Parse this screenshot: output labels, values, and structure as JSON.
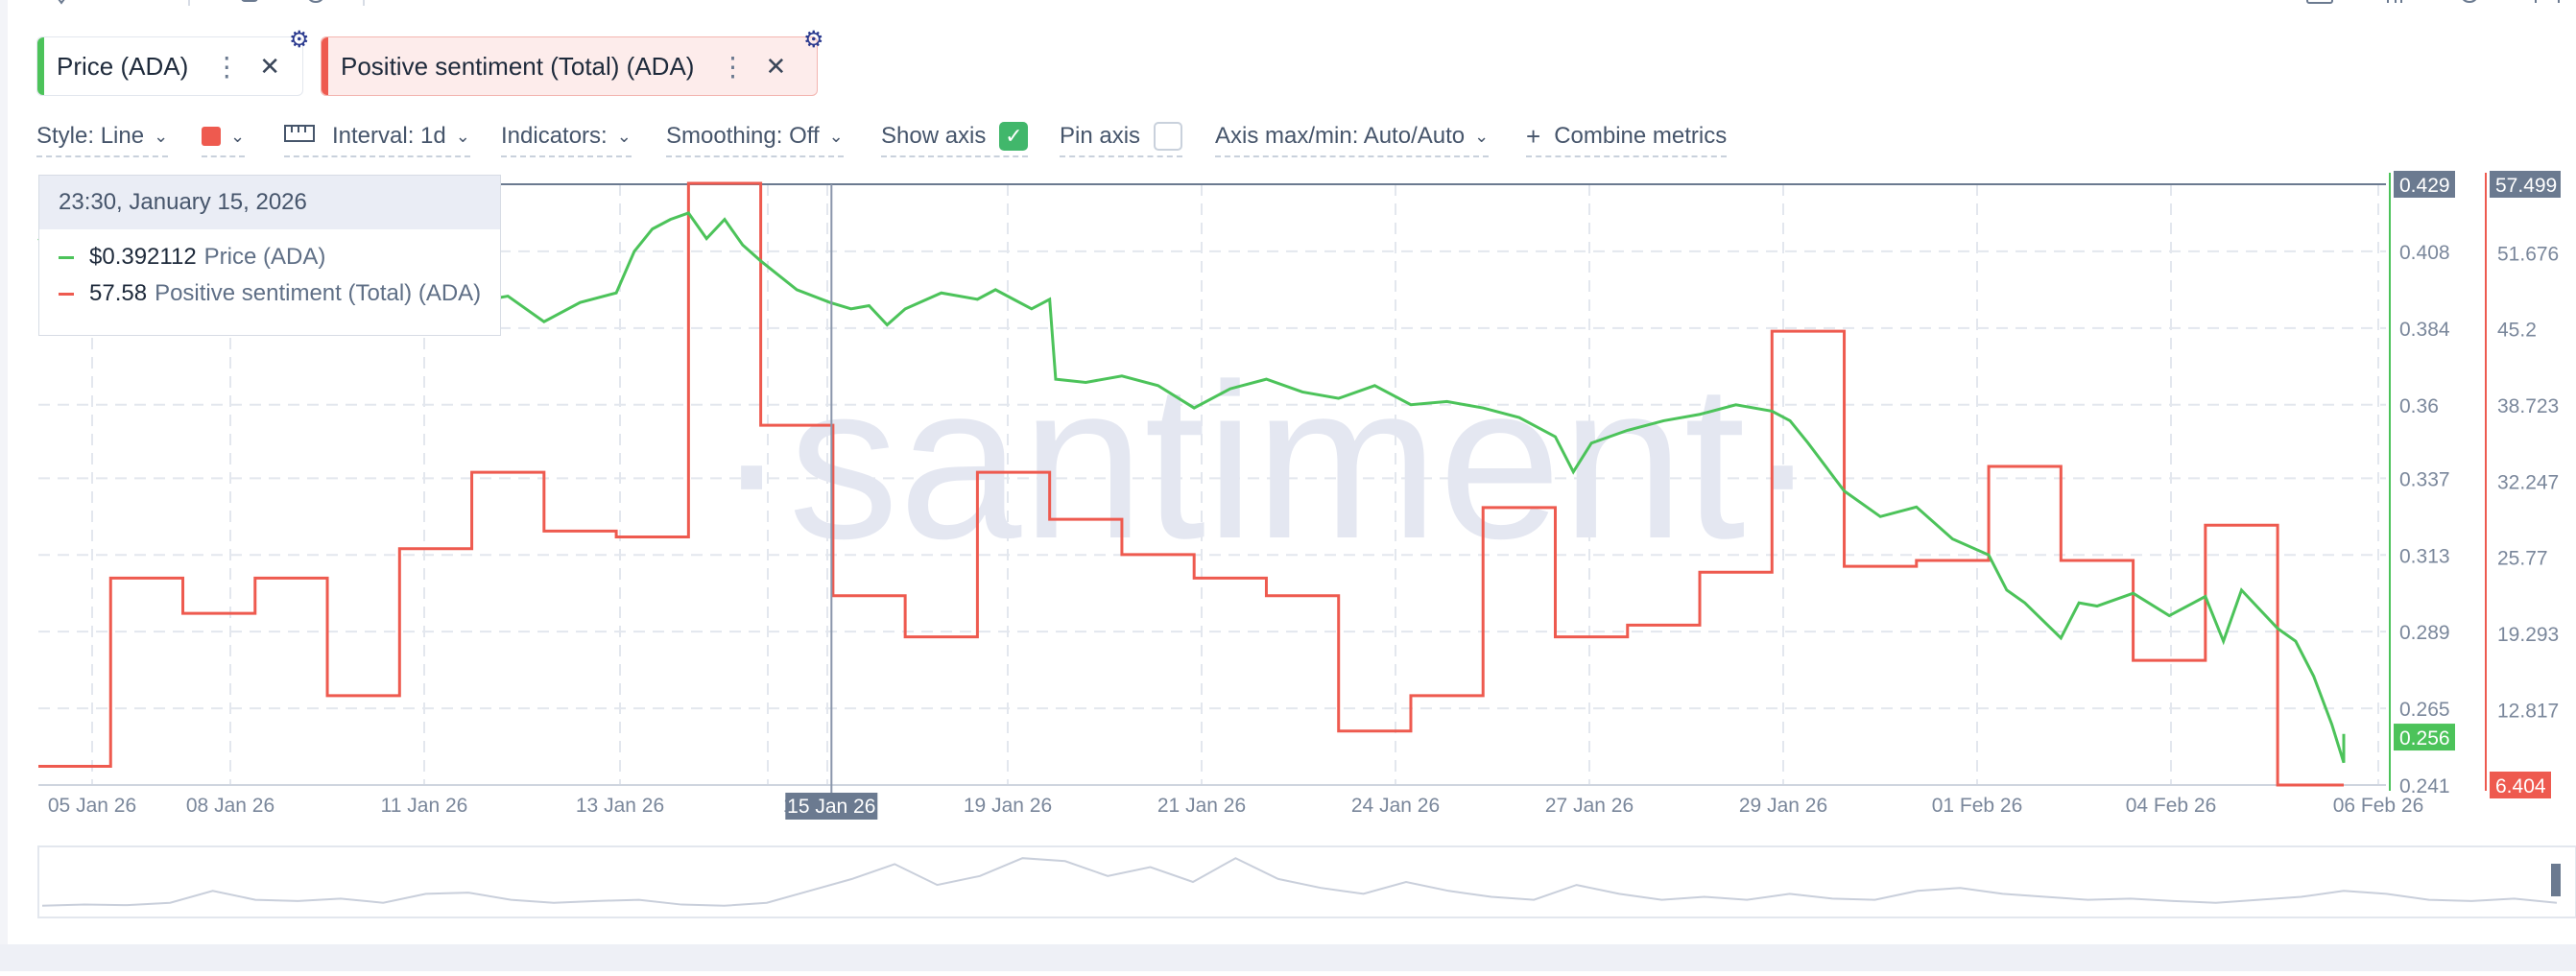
{
  "chips": [
    {
      "label": "Price (ADA)",
      "color": "#4cc35a"
    },
    {
      "label": "Positive sentiment (Total) (ADA)",
      "color": "#ee5a4f"
    }
  ],
  "toolbar": {
    "style": "Style: Line",
    "interval": "Interval: 1d",
    "indicators": "Indicators:",
    "smoothing": "Smoothing: Off",
    "show_axis": "Show axis",
    "pin_axis": "Pin axis",
    "axis_maxmin": "Axis max/min: Auto/Auto",
    "combine": "Combine metrics",
    "show_axis_checked": true,
    "pin_axis_checked": false
  },
  "tooltip": {
    "datetime": "23:30, January 15, 2026",
    "rows": [
      {
        "value": "$0.392112",
        "name": "Price (ADA)",
        "color": "#4cc35a"
      },
      {
        "value": "57.58",
        "name": "Positive sentiment (Total) (ADA)",
        "color": "#ee5a4f"
      }
    ]
  },
  "watermark": "·santiment·",
  "chart_data": {
    "type": "line",
    "x_tick_labels": [
      "05 Jan 26",
      "08 Jan 26",
      "11 Jan 26",
      "13 Jan 26",
      "15 Jan 26",
      "17 Jan 26",
      "19 Jan 26",
      "21 Jan 26",
      "24 Jan 26",
      "27 Jan 26",
      "29 Jan 26",
      "01 Feb 26",
      "04 Feb 26",
      "06 Feb 26"
    ],
    "highlighted_x_label": "15 Jan 26",
    "xlim": [
      "2026-01-05",
      "2026-02-06"
    ],
    "price_axis": {
      "ticks": [
        "0.408",
        "0.384",
        "0.36",
        "0.337",
        "0.313",
        "0.289",
        "0.265",
        "0.241"
      ],
      "ylim": [
        0.241,
        0.429
      ],
      "max_badge": "0.429",
      "last_badge": "0.256",
      "color": "#4cc35a"
    },
    "sentiment_axis": {
      "ticks": [
        "51.676",
        "45.2",
        "38.723",
        "32.247",
        "25.77",
        "19.293",
        "12.817"
      ],
      "ylim": [
        6.404,
        57.499
      ],
      "max_badge": "57.499",
      "min_badge": "6.404",
      "color": "#ee5a4f"
    },
    "grid": true,
    "series": [
      {
        "name": "Price (ADA)",
        "color": "#4cc35a",
        "step": false,
        "points": [
          [
            "2026-01-05",
            0.412
          ],
          [
            "2026-01-05T12",
            0.405
          ],
          [
            "2026-01-06",
            0.41
          ],
          [
            "2026-01-06T12",
            0.4
          ],
          [
            "2026-01-07",
            0.39
          ],
          [
            "2026-01-07T12",
            0.398
          ],
          [
            "2026-01-08",
            0.385
          ],
          [
            "2026-01-08T12",
            0.39
          ],
          [
            "2026-01-09",
            0.395
          ],
          [
            "2026-01-09T12",
            0.388
          ],
          [
            "2026-01-10",
            0.39
          ],
          [
            "2026-01-10T12",
            0.386
          ],
          [
            "2026-01-11",
            0.392
          ],
          [
            "2026-01-11T12",
            0.394
          ],
          [
            "2026-01-12",
            0.386
          ],
          [
            "2026-01-12T12",
            0.392
          ],
          [
            "2026-01-13",
            0.395
          ],
          [
            "2026-01-13T06",
            0.408
          ],
          [
            "2026-01-13T12",
            0.415
          ],
          [
            "2026-01-13T18",
            0.418
          ],
          [
            "2026-01-14",
            0.42
          ],
          [
            "2026-01-14T06",
            0.412
          ],
          [
            "2026-01-14T12",
            0.418
          ],
          [
            "2026-01-14T18",
            0.41
          ],
          [
            "2026-01-15",
            0.405
          ],
          [
            "2026-01-15T12",
            0.396
          ],
          [
            "2026-01-15T23",
            0.392
          ],
          [
            "2026-01-16T06",
            0.39
          ],
          [
            "2026-01-16T12",
            0.391
          ],
          [
            "2026-01-16T18",
            0.385
          ],
          [
            "2026-01-17",
            0.39
          ],
          [
            "2026-01-17T12",
            0.395
          ],
          [
            "2026-01-18",
            0.393
          ],
          [
            "2026-01-18T06",
            0.396
          ],
          [
            "2026-01-18T12",
            0.393
          ],
          [
            "2026-01-18T18",
            0.39
          ],
          [
            "2026-01-19",
            0.393
          ],
          [
            "2026-01-19T02",
            0.368
          ],
          [
            "2026-01-19T12",
            0.367
          ],
          [
            "2026-01-20",
            0.369
          ],
          [
            "2026-01-20T12",
            0.366
          ],
          [
            "2026-01-21",
            0.359
          ],
          [
            "2026-01-21T12",
            0.365
          ],
          [
            "2026-01-22",
            0.368
          ],
          [
            "2026-01-22T12",
            0.364
          ],
          [
            "2026-01-23",
            0.362
          ],
          [
            "2026-01-23T12",
            0.366
          ],
          [
            "2026-01-24",
            0.36
          ],
          [
            "2026-01-24T12",
            0.361
          ],
          [
            "2026-01-25",
            0.359
          ],
          [
            "2026-01-25T12",
            0.356
          ],
          [
            "2026-01-26",
            0.35
          ],
          [
            "2026-01-26T06",
            0.339
          ],
          [
            "2026-01-26T12",
            0.348
          ],
          [
            "2026-01-27",
            0.352
          ],
          [
            "2026-01-27T12",
            0.355
          ],
          [
            "2026-01-28",
            0.357
          ],
          [
            "2026-01-28T12",
            0.36
          ],
          [
            "2026-01-29",
            0.358
          ],
          [
            "2026-01-29T06",
            0.355
          ],
          [
            "2026-01-29T12",
            0.348
          ],
          [
            "2026-01-30",
            0.333
          ],
          [
            "2026-01-30T12",
            0.325
          ],
          [
            "2026-01-31",
            0.328
          ],
          [
            "2026-01-31T12",
            0.318
          ],
          [
            "2026-02-01",
            0.313
          ],
          [
            "2026-02-01T06",
            0.302
          ],
          [
            "2026-02-01T12",
            0.298
          ],
          [
            "2026-02-02",
            0.287
          ],
          [
            "2026-02-02T06",
            0.298
          ],
          [
            "2026-02-02T12",
            0.297
          ],
          [
            "2026-02-03",
            0.301
          ],
          [
            "2026-02-03T12",
            0.294
          ],
          [
            "2026-02-04",
            0.3
          ],
          [
            "2026-02-04T06",
            0.286
          ],
          [
            "2026-02-04T12",
            0.302
          ],
          [
            "2026-02-05",
            0.29
          ],
          [
            "2026-02-05T06",
            0.286
          ],
          [
            "2026-02-05T12",
            0.275
          ],
          [
            "2026-02-05T18",
            0.26
          ],
          [
            "2026-02-06",
            0.248
          ],
          [
            "2026-02-06T06",
            0.257
          ],
          [
            "2026-02-06T12",
            0.252
          ],
          [
            "2026-02-06T18",
            0.256
          ]
        ]
      },
      {
        "name": "Positive sentiment (Total) (ADA)",
        "color": "#ee5a4f",
        "step": true,
        "points": [
          [
            "2026-01-04",
            8.0
          ],
          [
            "2026-01-06",
            24.0
          ],
          [
            "2026-01-07",
            21.0
          ],
          [
            "2026-01-08",
            24.0
          ],
          [
            "2026-01-09",
            14.0
          ],
          [
            "2026-01-10",
            26.5
          ],
          [
            "2026-01-11",
            33.0
          ],
          [
            "2026-01-12",
            28.0
          ],
          [
            "2026-01-13",
            27.5
          ],
          [
            "2026-01-14",
            57.58
          ],
          [
            "2026-01-15",
            37.0
          ],
          [
            "2026-01-16",
            22.5
          ],
          [
            "2026-01-17",
            19.0
          ],
          [
            "2026-01-18",
            33.0
          ],
          [
            "2026-01-19",
            29.0
          ],
          [
            "2026-01-20",
            26.0
          ],
          [
            "2026-01-21",
            24.0
          ],
          [
            "2026-01-22",
            22.5
          ],
          [
            "2026-01-23",
            11.0
          ],
          [
            "2026-01-24",
            14.0
          ],
          [
            "2026-01-25",
            30.0
          ],
          [
            "2026-01-26",
            19.0
          ],
          [
            "2026-01-27",
            20.0
          ],
          [
            "2026-01-28",
            24.5
          ],
          [
            "2026-01-29",
            45.0
          ],
          [
            "2026-01-30",
            25.0
          ],
          [
            "2026-01-31",
            25.5
          ],
          [
            "2026-02-01",
            33.5
          ],
          [
            "2026-02-02",
            25.5
          ],
          [
            "2026-02-03",
            17.0
          ],
          [
            "2026-02-04",
            28.5
          ],
          [
            "2026-02-05",
            6.404
          ],
          [
            "2026-02-06",
            6.404
          ]
        ]
      }
    ],
    "tooltip_x": "2026-01-15T23:30",
    "navigator": {
      "type": "area",
      "values": [
        0.1,
        0.12,
        0.11,
        0.15,
        0.35,
        0.2,
        0.18,
        0.22,
        0.15,
        0.3,
        0.32,
        0.2,
        0.15,
        0.18,
        0.2,
        0.12,
        0.1,
        0.15,
        0.35,
        0.55,
        0.8,
        0.45,
        0.6,
        0.9,
        0.85,
        0.6,
        0.75,
        0.5,
        0.9,
        0.55,
        0.4,
        0.3,
        0.5,
        0.35,
        0.25,
        0.2,
        0.45,
        0.3,
        0.2,
        0.25,
        0.2,
        0.3,
        0.22,
        0.2,
        0.35,
        0.4,
        0.3,
        0.25,
        0.2,
        0.22,
        0.18,
        0.15,
        0.2,
        0.25,
        0.35,
        0.3,
        0.2,
        0.18,
        0.22,
        0.15
      ]
    }
  }
}
